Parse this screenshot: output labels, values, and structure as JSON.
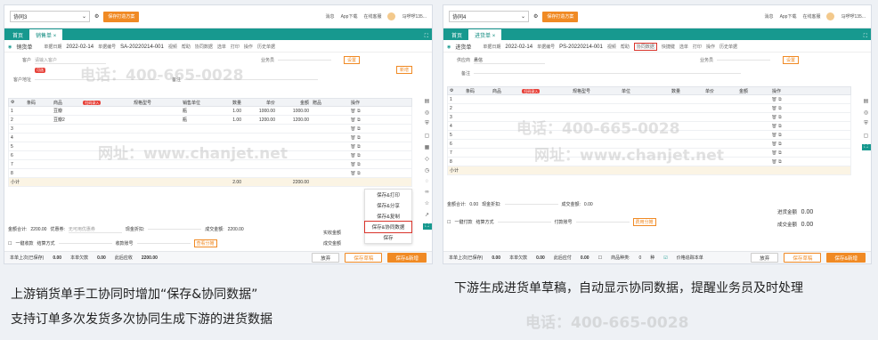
{
  "left": {
    "account": "协同3",
    "plan_button": "保存打造方案",
    "top_right": [
      "消息",
      "App下载",
      "在线客服",
      "马啰啰135..."
    ],
    "tabs": [
      "首页",
      "销售单"
    ],
    "doc_title": "销货单",
    "toolbar": [
      "单据日期",
      "2022-02-14",
      "单据编号",
      "SA-20220214-001",
      "视频",
      "帮助",
      "协同数据",
      "选单",
      "打印",
      "操作",
      "历史单据"
    ],
    "form": {
      "customer_label": "客户",
      "customer_placeholder": "请输入客户",
      "customer_tag": "可选",
      "salesman_label": "业务员",
      "address_label": "客户地址",
      "remark_label": "备注",
      "settings": "设置",
      "add": "新增"
    },
    "columns": [
      "条码",
      "商品",
      "规格型号",
      "销售单位",
      "数量",
      "单价",
      "金额",
      "赠品",
      "操作"
    ],
    "scan_tag": "扫码录入",
    "rows": [
      {
        "no": "1",
        "item": "豆瓣",
        "unit": "瓶",
        "qty": "1.00",
        "price": "1000.00",
        "amount": "1000.00"
      },
      {
        "no": "2",
        "item": "豆瓣2",
        "unit": "瓶",
        "qty": "1.00",
        "price": "1200.00",
        "amount": "1200.00"
      },
      {
        "no": "3"
      },
      {
        "no": "4"
      },
      {
        "no": "5"
      },
      {
        "no": "6"
      },
      {
        "no": "7"
      },
      {
        "no": "8"
      }
    ],
    "subtotal": {
      "label": "小计",
      "qty": "2.00",
      "amount": "2200.00"
    },
    "summary": [
      "金额合计:",
      "2200.00",
      "优惠券:",
      "无可用优惠券",
      "现金折扣:",
      "成交金额:",
      "2200.00"
    ],
    "summary2": [
      "实收金额",
      "成交金额"
    ],
    "options": [
      "一键收款",
      "结算方式",
      "收款账号",
      "查看分摊"
    ],
    "popup": [
      "保存&打印",
      "保存&分享",
      "保存&复制",
      "保存&协同数据",
      "保存"
    ],
    "footer": [
      "本单上次(已保存)",
      "0.00",
      "本单欠款",
      "0.00",
      "此后应收",
      "2200.00"
    ],
    "buttons": [
      "放弃",
      "保存草稿",
      "保存&新增"
    ],
    "side_icons": [
      "form-icon",
      "target-icon",
      "shield-icon",
      "doc-icon",
      "calendar-icon",
      "tag-icon",
      "clock-icon",
      "chat-icon",
      "link-icon",
      "star-icon",
      "arrow-icon",
      "active-icon"
    ]
  },
  "right": {
    "account": "协同4",
    "plan_button": "保存打造方案",
    "top_right": [
      "消息",
      "App下载",
      "在线客服",
      "马啰啰135..."
    ],
    "tabs": [
      "首页",
      "进货单"
    ],
    "doc_title": "进货单",
    "toolbar": [
      "单据日期",
      "2022-02-14",
      "单据编号",
      "PS-20220214-001",
      "视频",
      "帮助",
      "协同数据",
      "快捷键",
      "选单",
      "打印",
      "操作",
      "历史单据"
    ],
    "form": {
      "supplier_label": "供应商",
      "supplier_placeholder": "悬信",
      "salesman_label": "业务员",
      "remark_label": "备注",
      "settings": "设置"
    },
    "columns": [
      "条码",
      "商品",
      "规格型号",
      "单位",
      "数量",
      "单价",
      "金额",
      "操作"
    ],
    "scan_tag": "扫码录入",
    "rows": [
      {
        "no": "1"
      },
      {
        "no": "2"
      },
      {
        "no": "3"
      },
      {
        "no": "4"
      },
      {
        "no": "5"
      },
      {
        "no": "6"
      },
      {
        "no": "7"
      },
      {
        "no": "8"
      }
    ],
    "subtotal": {
      "label": "小计"
    },
    "summary": [
      "金额合计:",
      "0.00",
      "现金折扣:",
      "成交金额:",
      "0.00"
    ],
    "summary2": [
      {
        "label": "进货金额",
        "value": "0.00"
      },
      {
        "label": "成交金额",
        "value": "0.00"
      }
    ],
    "options": [
      "一键付款",
      "结算方式",
      "付款账号",
      "费用分摊"
    ],
    "footer": [
      "本单上次(已保存)",
      "0.00",
      "本单欠款",
      "0.00",
      "此后应付",
      "0.00",
      "商品种类:",
      "0",
      "种",
      "价格追踪本单"
    ],
    "buttons": [
      "放弃",
      "保存草稿",
      "保存&新增"
    ]
  },
  "captions": {
    "left_line1": "上游销货单手工协同时增加“保存&协同数据”",
    "left_line2": "支持订单多次发货多次协同生成下游的进货数据",
    "right": "下游生成进货单草稿，自动显示协同数据，提醒业务员及时处理"
  },
  "watermarks": [
    "电话：400-665-0028",
    "网址：www.chanjet.net"
  ],
  "colors": {
    "teal": "#17998f",
    "orange": "#f08a24",
    "highlight": "#d9342b"
  }
}
